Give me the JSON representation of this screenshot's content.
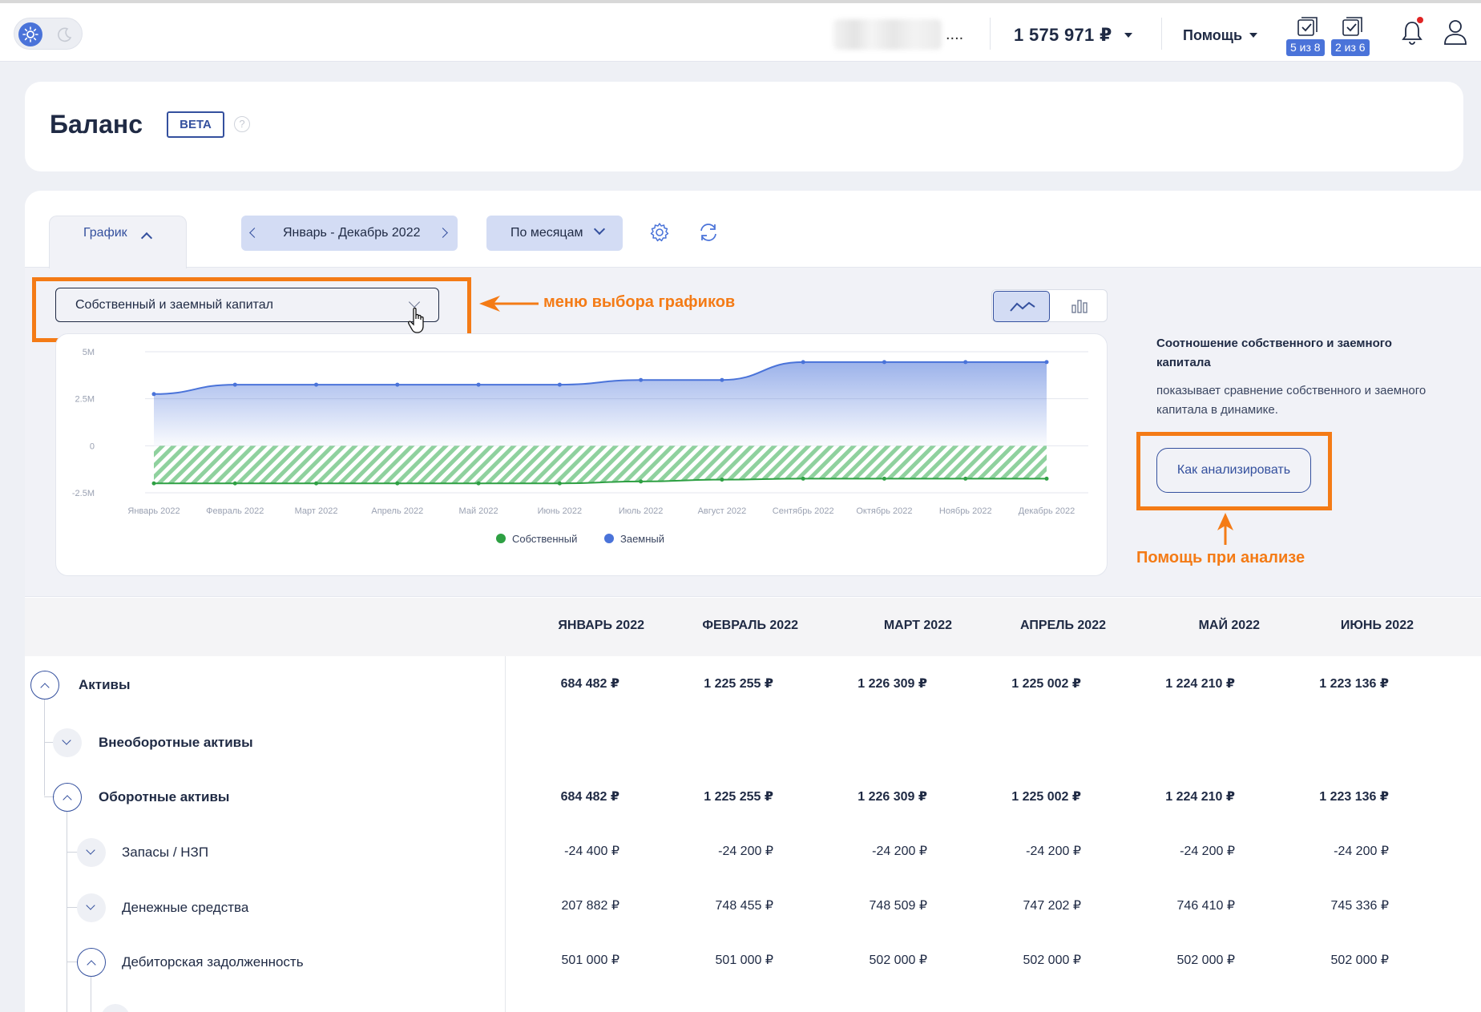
{
  "header": {
    "user_dots": "....",
    "balance": "1 575 971 ₽",
    "help_label": "Помощь",
    "tasks": [
      {
        "icon": "checklist-icon",
        "badge": "5 из 8"
      },
      {
        "icon": "checklist-icon",
        "badge": "2 из 6"
      }
    ]
  },
  "page": {
    "title": "Баланс",
    "badge": "BETA",
    "help_icon": "?"
  },
  "toolbar": {
    "tab_label": "График",
    "period": "Январь - Декабрь 2022",
    "grouping": "По месяцам"
  },
  "chart_selector": {
    "value": "Собственный и заемный капитал"
  },
  "annotations": {
    "chart_menu": "меню выбора графиков",
    "analysis_help": "Помощь при анализе"
  },
  "info_panel": {
    "title": "Соотношение собственного и заемного капитала",
    "description": "показывает сравнение собственного и заемного капитала в динамике.",
    "button": "Как анализировать"
  },
  "colors": {
    "accent": "#4a73d9",
    "annotation": "#f47b16",
    "own_series": "#2ea043",
    "borrowed_series": "#4a73d9"
  },
  "chart_data": {
    "type": "area",
    "x": [
      "Январь 2022",
      "Февраль 2022",
      "Март 2022",
      "Апрель 2022",
      "Май 2022",
      "Июнь 2022",
      "Июль 2022",
      "Август 2022",
      "Сентябрь 2022",
      "Октябрь 2022",
      "Ноябрь 2022",
      "Декабрь 2022"
    ],
    "y_ticks": [
      "5M",
      "2.5M",
      "0",
      "-2.5M"
    ],
    "ylim": [
      -2.5,
      5
    ],
    "y_unit": "M",
    "series": [
      {
        "name": "Собственный",
        "color": "#2ea043",
        "values": [
          -2.0,
          -2.0,
          -2.0,
          -2.0,
          -2.0,
          -2.0,
          -1.9,
          -1.8,
          -1.75,
          -1.75,
          -1.75,
          -1.75
        ]
      },
      {
        "name": "Заемный",
        "color": "#4a73d9",
        "values": [
          2.75,
          3.25,
          3.25,
          3.25,
          3.25,
          3.25,
          3.5,
          3.5,
          4.45,
          4.45,
          4.45,
          4.45
        ]
      }
    ],
    "grid": true,
    "legend_position": "bottom-center"
  },
  "table": {
    "columns": [
      "ЯНВАРЬ 2022",
      "ФЕВРАЛЬ 2022",
      "МАРТ 2022",
      "АПРЕЛЬ 2022",
      "МАЙ 2022",
      "ИЮНЬ 2022"
    ],
    "rows": [
      {
        "label": "Активы",
        "values": [
          "684 482 ₽",
          "1 225 255 ₽",
          "1 226 309 ₽",
          "1 225 002 ₽",
          "1 224 210 ₽",
          "1 223 136 ₽"
        ]
      },
      {
        "label": "Внеоборотные активы",
        "values": []
      },
      {
        "label": "Оборотные активы",
        "values": [
          "684 482 ₽",
          "1 225 255 ₽",
          "1 226 309 ₽",
          "1 225 002 ₽",
          "1 224 210 ₽",
          "1 223 136 ₽"
        ]
      },
      {
        "label": "Запасы / НЗП",
        "values": [
          "-24 400 ₽",
          "-24 200 ₽",
          "-24 200 ₽",
          "-24 200 ₽",
          "-24 200 ₽",
          "-24 200 ₽"
        ]
      },
      {
        "label": "Денежные средства",
        "values": [
          "207 882 ₽",
          "748 455 ₽",
          "748 509 ₽",
          "747 202 ₽",
          "746 410 ₽",
          "745 336 ₽"
        ]
      },
      {
        "label": "Дебиторская задолженность",
        "values": [
          "501 000 ₽",
          "501 000 ₽",
          "502 000 ₽",
          "502 000 ₽",
          "502 000 ₽",
          "502 000 ₽"
        ]
      }
    ]
  }
}
